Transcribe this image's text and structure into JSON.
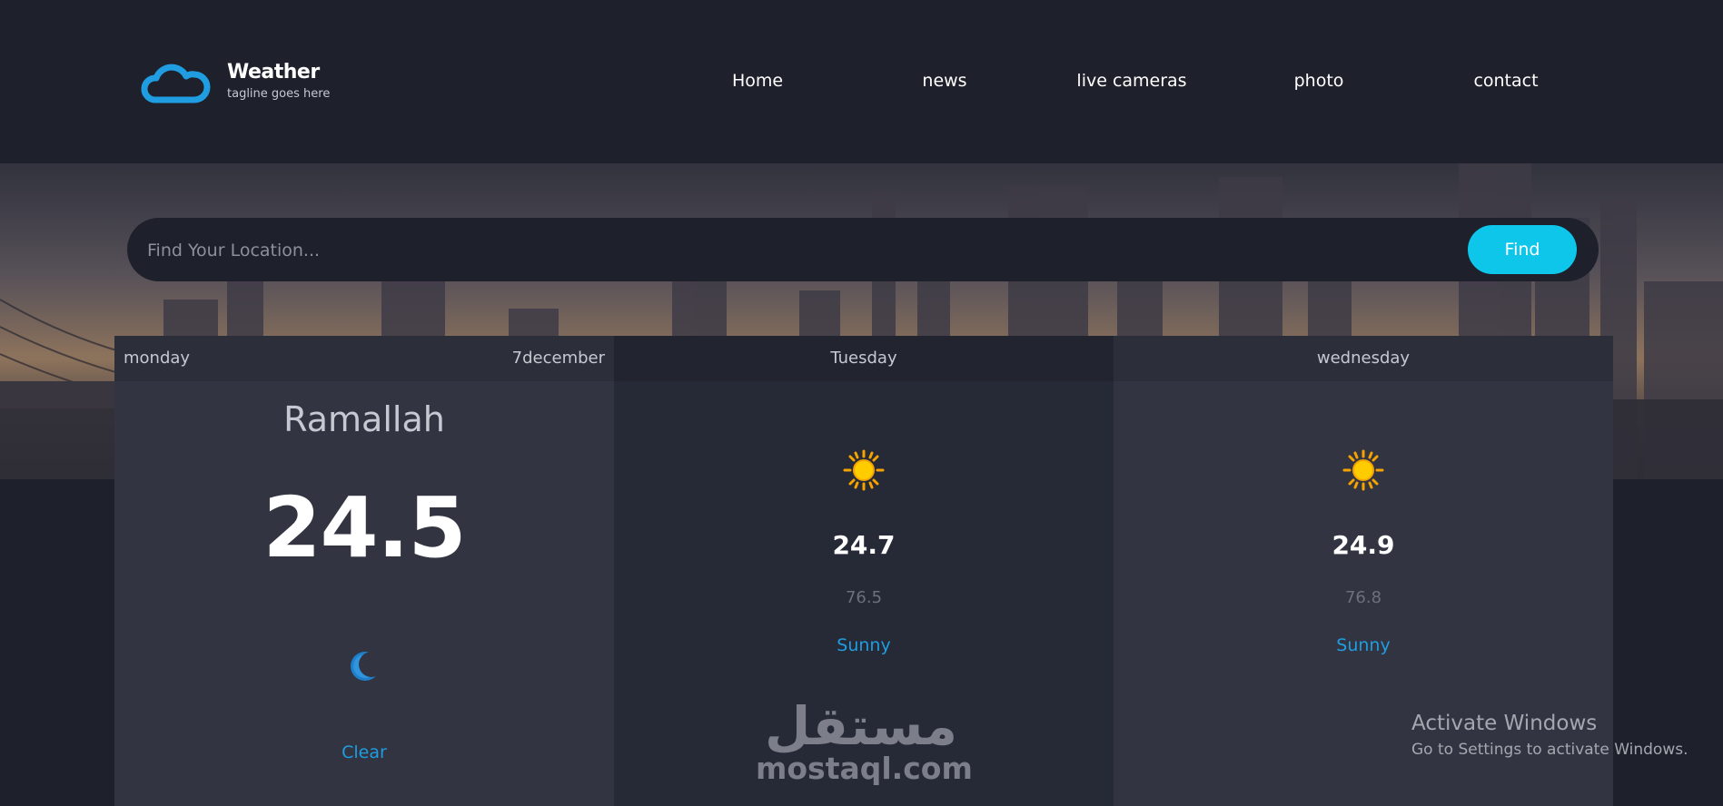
{
  "brand": {
    "name": "Weather",
    "tagline": "tagline goes here",
    "logo_icon": "cloud-icon",
    "accent_color": "#1f9de0"
  },
  "nav": {
    "items": [
      "Home",
      "news",
      "live cameras",
      "photo",
      "contact"
    ]
  },
  "search": {
    "placeholder": "Find Your Location...",
    "button_label": "Find",
    "button_color": "#0ec6ea"
  },
  "today": {
    "day": "monday",
    "date": "7december",
    "city": "Ramallah",
    "temperature": "24.5",
    "icon": "moon-icon",
    "condition": "Clear"
  },
  "forecast": [
    {
      "day": "Tuesday",
      "icon": "sun-icon",
      "high": "24.7",
      "low": "76.5",
      "condition": "Sunny"
    },
    {
      "day": "wednesday",
      "icon": "sun-icon",
      "high": "24.9",
      "low": "76.8",
      "condition": "Sunny"
    }
  ],
  "watermark": {
    "arabic": "مستقل",
    "latin": "mostaql.com"
  },
  "os_notice": {
    "title": "Activate Windows",
    "subtitle": "Go to Settings to activate Windows."
  }
}
